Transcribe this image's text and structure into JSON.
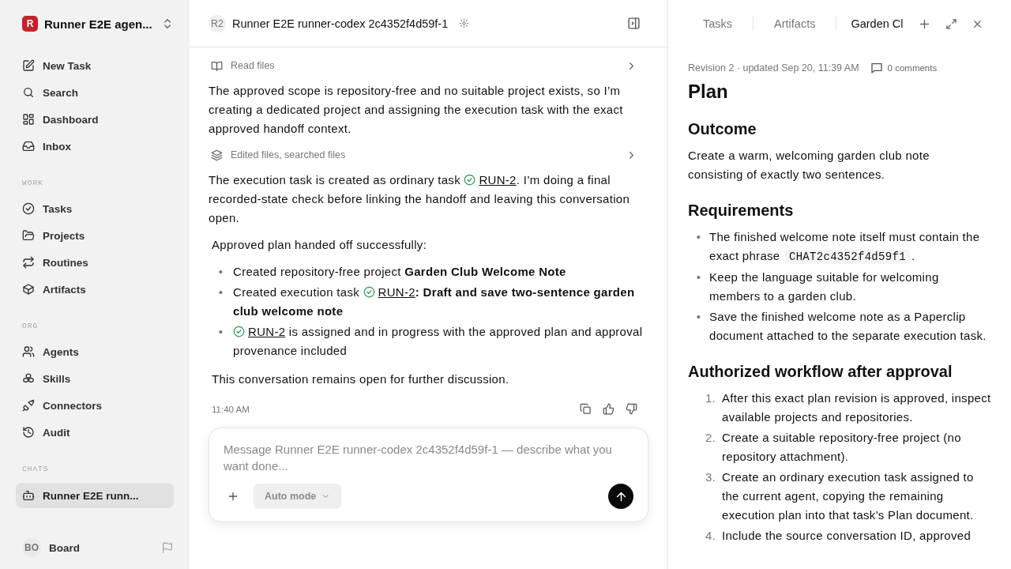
{
  "sidebar": {
    "workspace": {
      "logo_letter": "R",
      "name": "Runner E2E agen..."
    },
    "nav": [
      {
        "label": "New Task"
      },
      {
        "label": "Search"
      },
      {
        "label": "Dashboard"
      },
      {
        "label": "Inbox"
      }
    ],
    "sections": [
      {
        "title": "WORK",
        "items": [
          {
            "label": "Tasks"
          },
          {
            "label": "Projects"
          },
          {
            "label": "Routines"
          },
          {
            "label": "Artifacts"
          }
        ]
      },
      {
        "title": "ORG",
        "items": [
          {
            "label": "Agents"
          },
          {
            "label": "Skills"
          },
          {
            "label": "Connectors"
          },
          {
            "label": "Audit"
          }
        ]
      }
    ],
    "chats": {
      "title": "CHATS",
      "items": [
        {
          "label": "Runner E2E runn...",
          "selected": true
        }
      ]
    },
    "user": {
      "initials": "BO",
      "name": "Board"
    }
  },
  "chat": {
    "header": {
      "avatar": "R2",
      "title": "Runner E2E runner-codex 2c4352f4d59f-1"
    },
    "blocks": [
      {
        "kind": "activity",
        "label": "Read files"
      },
      {
        "kind": "paragraph",
        "parts": [
          {
            "text": "The approved scope is repository-free and no suitable project exists, so I’m creating a dedicated project and assigning the execution task with the exact approved handoff context."
          }
        ]
      },
      {
        "kind": "activity",
        "label": "Edited files, searched files"
      },
      {
        "kind": "paragraph",
        "parts": [
          {
            "text": "The execution task is created as ordinary task "
          },
          {
            "kind": "task_link",
            "text": "RUN-2"
          },
          {
            "text": ". I’m doing a final recorded-state check before linking the handoff and leaving this conversation open."
          }
        ]
      },
      {
        "kind": "summary",
        "parts": [
          {
            "text": "Approved plan handed off successfully:"
          }
        ]
      },
      {
        "kind": "bullets",
        "items": [
          {
            "marker": "•",
            "parts": [
              {
                "text": "Created repository-free project **Garden Club Welcome Note**"
              }
            ]
          },
          {
            "marker": "•",
            "parts": [
              {
                "text": "Created execution task "
              },
              {
                "kind": "task_link",
                "text": "RUN-2"
              },
              {
                "text": "**: Draft and save two-sentence garden club welcome note**"
              }
            ]
          },
          {
            "marker": "•",
            "parts": [
              {
                "kind": "task_link",
                "text": "RUN-2"
              },
              {
                "text": " is assigned and in progress with the approved plan and approval provenance included"
              }
            ]
          }
        ]
      },
      {
        "kind": "summary",
        "parts": [
          {
            "text": "This conversation remains open for further discussion."
          }
        ]
      }
    ],
    "timestamp": "11:40 AM",
    "composer": {
      "placeholder": "Message Runner E2E runner-codex 2c4352f4d59f-1 — describe what you want done...",
      "mode": "Auto mode"
    }
  },
  "panel": {
    "tabs": [
      {
        "label": "Tasks",
        "selected": false
      },
      {
        "label": "Artifacts",
        "selected": false
      },
      {
        "label": "Garden Cl",
        "selected": true
      }
    ],
    "meta": "Revision 2 · updated Sep 20, 11:39 AM",
    "comments": "0 comments",
    "title": "Plan",
    "sections": [
      {
        "heading": "Outcome",
        "kind": "text",
        "parts": [
          {
            "text": "Create a warm, welcoming garden club note consisting of exactly two sentences."
          }
        ]
      },
      {
        "heading": "Requirements",
        "kind": "bullets",
        "items": [
          {
            "marker": "•",
            "parts": [
              {
                "text": "The finished welcome note itself must contain the exact phrase "
              },
              {
                "kind": "code",
                "text": "CHAT2c4352f4d59f1"
              },
              {
                "text": "."
              }
            ]
          },
          {
            "marker": "•",
            "parts": [
              {
                "text": "Keep the language suitable for welcoming members to a garden club."
              }
            ]
          },
          {
            "marker": "•",
            "parts": [
              {
                "text": "Save the finished welcome note as a Paperclip document attached to the separate execution task."
              }
            ]
          }
        ]
      },
      {
        "heading": "Authorized workflow after approval",
        "kind": "numbered",
        "items": [
          {
            "number": "1.",
            "parts": [
              {
                "text": "After this exact plan revision is approved, inspect available projects and repositories."
              }
            ]
          },
          {
            "number": "2.",
            "parts": [
              {
                "text": "Create a suitable repository-free project (no repository attachment)."
              }
            ]
          },
          {
            "number": "3.",
            "parts": [
              {
                "text": "Create an ordinary execution task assigned to the current agent, copying the remaining execution plan into that task's Plan document."
              }
            ]
          },
          {
            "number": "4.",
            "parts": [
              {
                "text": "Include the source conversation ID, approved"
              }
            ]
          }
        ]
      }
    ]
  }
}
